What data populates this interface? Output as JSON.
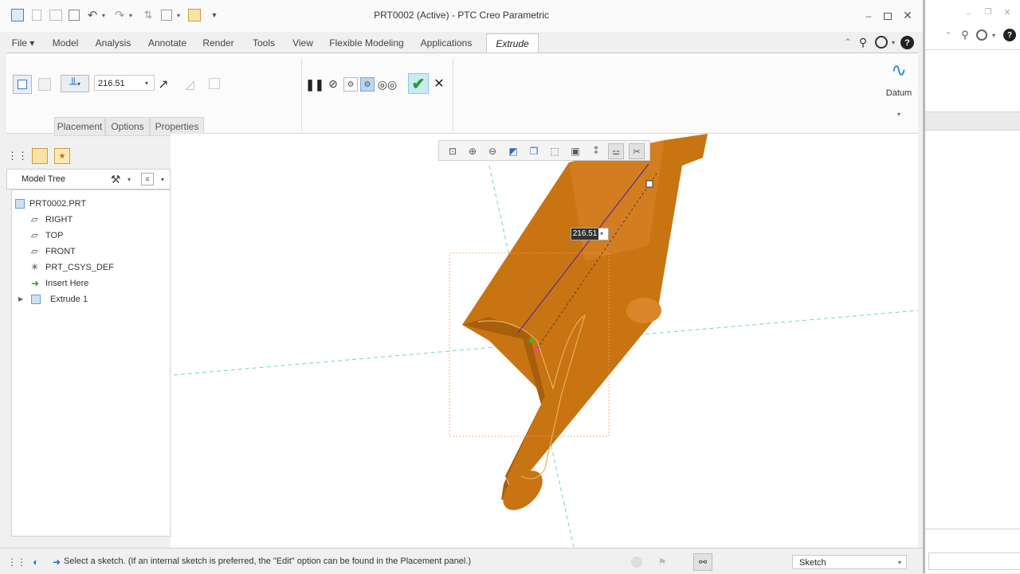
{
  "window": {
    "title": "PRT0002 (Active) - PTC Creo Parametric"
  },
  "tabs": [
    {
      "label": "File ▾"
    },
    {
      "label": "Model"
    },
    {
      "label": "Analysis"
    },
    {
      "label": "Annotate"
    },
    {
      "label": "Render"
    },
    {
      "label": "Tools"
    },
    {
      "label": "View"
    },
    {
      "label": "Flexible Modeling"
    },
    {
      "label": "Applications"
    },
    {
      "label": "Extrude"
    }
  ],
  "ribbon": {
    "depth_value": "216.51",
    "datum_label": "Datum",
    "subtabs": [
      {
        "label": "Placement"
      },
      {
        "label": "Options"
      },
      {
        "label": "Properties"
      }
    ]
  },
  "model_tree": {
    "title": "Model Tree",
    "items": [
      {
        "label": "PRT0002.PRT"
      },
      {
        "label": "RIGHT"
      },
      {
        "label": "TOP"
      },
      {
        "label": "FRONT"
      },
      {
        "label": "PRT_CSYS_DEF"
      },
      {
        "label": "Insert Here"
      },
      {
        "label": "Extrude 1"
      }
    ]
  },
  "viewport": {
    "dim_value": "216.51"
  },
  "status": {
    "message": "Select a sketch. (If an internal sketch is preferred, the \"Edit\" option can be found in the Placement panel.)",
    "filter": "Sketch"
  },
  "colors": {
    "part": "#c87412",
    "accent": "#2a8fd8",
    "confirm": "#2a9d2a"
  }
}
